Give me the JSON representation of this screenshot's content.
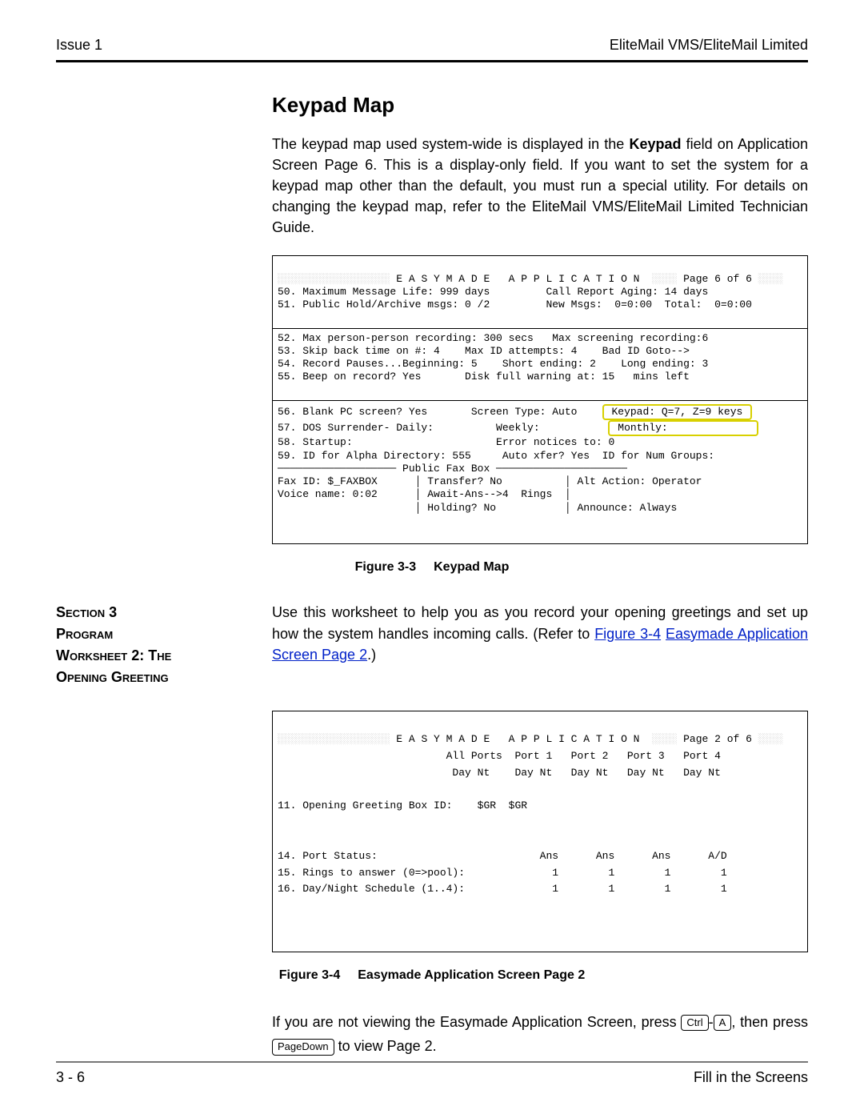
{
  "header": {
    "left": "Issue 1",
    "right": "EliteMail VMS/EliteMail Limited"
  },
  "heading1": "Keypad Map",
  "para1_before_strong": "The keypad map used system-wide is displayed in the ",
  "para1_strong": "Keypad",
  "para1_after_strong": " field on Application Screen Page 6. This is a display-only field. If you want to set the system for a keypad map other than the default, you must run a special utility. For details on changing the keypad map, refer to the EliteMail VMS/EliteMail Limited Technician Guide.",
  "screen1": {
    "title_pre": "░░░░░░░░░░░░░░░░░░",
    "title_main": " E A S Y M A D E   A P P L I C A T I O N  ",
    "title_post": "░░░░",
    "title_page": " Page 6 of 6 ",
    "title_end": "░░░░",
    "line50": "50. Maximum Message Life: 999 days         Call Report Aging: 14 days",
    "line51": "51. Public Hold/Archive msgs: 0 /2         New Msgs:  0=0:00  Total:  0=0:00",
    "line52": "52. Max person-person recording: 300 secs   Max screening recording:6",
    "line53": "53. Skip back time on #: 4    Max ID attempts: 4    Bad ID Goto-->",
    "line54": "54. Record Pauses...Beginning: 5    Short ending: 2    Long ending: 3",
    "line55": "55. Beep on record? Yes       Disk full warning at: 15   mins left",
    "line56_a": "56. Blank PC screen? Yes       Screen Type: Auto    ",
    "line56_hi": " Keypad: Q=7, Z=9 keys ",
    "line57_a": "57. DOS Surrender- Daily:          Weekly:           ",
    "line57_hi": " Monthly:              ",
    "line58": "58. Startup:                       Error notices to: 0",
    "line59": "59. ID for Alpha Directory: 555     Auto xfer? Yes  ID for Num Groups:",
    "pubFax": "─────────────────── Public Fax Box ─────────────────────",
    "faxRow1": "Fax ID: $_FAXBOX      │ Transfer? No          │ Alt Action: Operator",
    "faxRow2": "Voice name: 0:02      │ Await-Ans-->4  Rings  │",
    "faxRow3": "                      │ Holding? No           │ Announce: Always"
  },
  "fig1": {
    "num": "Figure 3-3",
    "title": "Keypad Map"
  },
  "section": {
    "labelLine1": "Section 3",
    "labelLine2": "Program",
    "labelLine3": "Worksheet 2:  The",
    "labelLine4": "Opening Greeting",
    "body_before_link": "Use this worksheet to help you as you record your opening greetings and set up how the system handles incoming calls.  (Refer to ",
    "link1": "Figure 3-4",
    "body_mid": " ",
    "link2": "Easymade Application Screen Page 2",
    "body_after_link": ".)"
  },
  "screen2": {
    "title_pre": "░░░░░░░░░░░░░░░░░░",
    "title_main": " E A S Y M A D E   A P P L I C A T I O N  ",
    "title_post": "░░░░",
    "title_page": " Page 2 of 6 ",
    "title_end": "░░░░",
    "hdr1": "                           All Ports  Port 1   Port 2   Port 3   Port 4",
    "hdr2": "                            Day Nt    Day Nt   Day Nt   Day Nt   Day Nt",
    "line11": "11. Opening Greeting Box ID:    $GR  $GR",
    "line14": "14. Port Status:                          Ans      Ans      Ans      A/D",
    "line15": "15. Rings to answer (0=>pool):              1        1        1        1",
    "line16": "16. Day/Night Schedule (1..4):              1        1        1        1"
  },
  "fig2": {
    "num": "Figure 3-4",
    "title": "Easymade Application Screen Page 2"
  },
  "afterText1": "If you are not viewing the Easymade Application Screen, press ",
  "key1a": "Ctrl",
  "keyDash": "-",
  "key1b": "A",
  "afterText1b": ", then press ",
  "key2": "PageDown",
  "afterText1c": " to view Page 2.",
  "footer": {
    "left": "3 - 6",
    "right": "Fill in the Screens"
  }
}
